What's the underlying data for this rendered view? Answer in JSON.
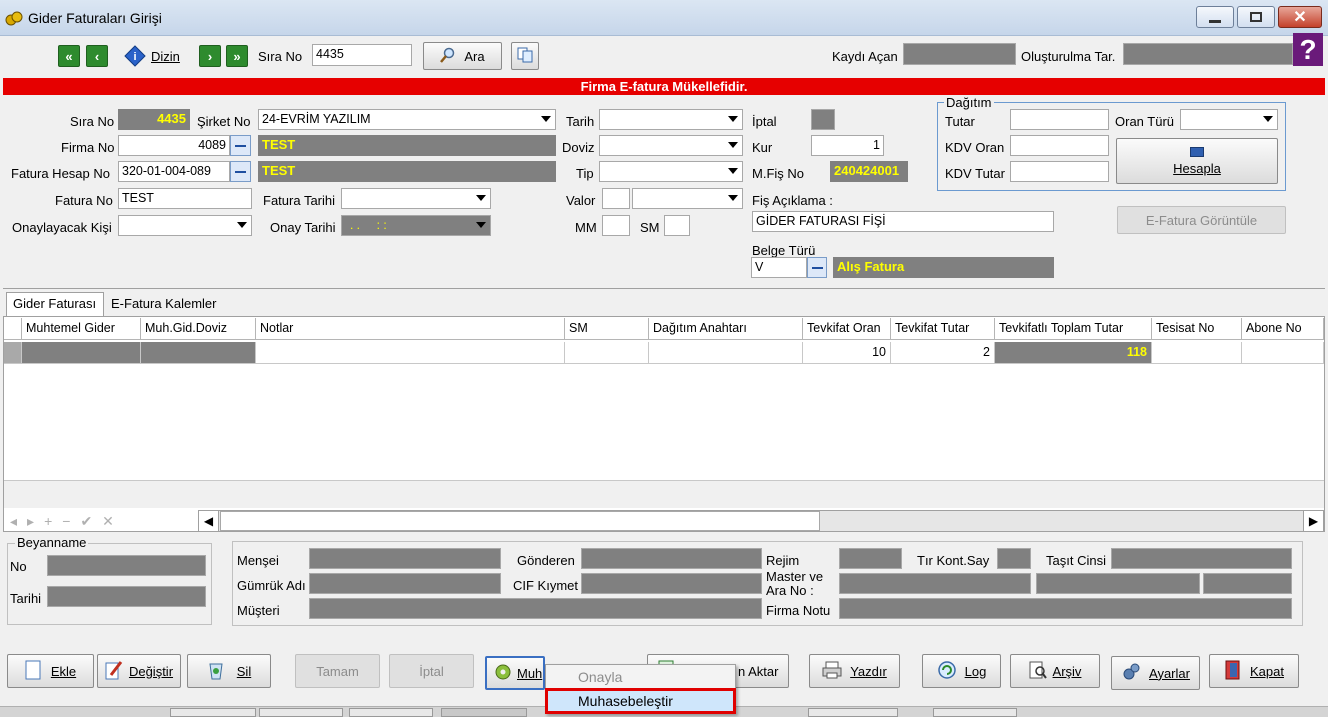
{
  "window": {
    "title": "Gider Faturaları Girişi"
  },
  "toolbar": {
    "dizin_label": "Dizin",
    "sira_no_label": "Sıra No",
    "sira_no_value": "4435",
    "ara_label": "Ara",
    "kaydi_acan_label": "Kaydı Açan",
    "olusturma_label": "Oluşturulma Tar."
  },
  "banner": {
    "text": "Firma E-fatura Mükellefidir."
  },
  "form": {
    "sira_no_label": "Sıra No",
    "sira_no_value": "4435",
    "sirket_no_label": "Şirket No",
    "sirket_no_value": "24-EVRİM YAZILIM",
    "tarih_label": "Tarih",
    "iptal_label": "İptal",
    "firma_no_label": "Firma No",
    "firma_no_value": "4089",
    "firma_name": "TEST",
    "doviz_label": "Doviz",
    "kur_label": "Kur",
    "kur_value": "1",
    "fatura_hesap_label": "Fatura Hesap No",
    "fatura_hesap_value": "320-01-004-089",
    "fatura_hesap_name": "TEST",
    "tip_label": "Tip",
    "mfis_label": "M.Fiş No",
    "mfis_value": "240424001",
    "fatura_no_label": "Fatura No",
    "fatura_no_value": "TEST",
    "fatura_tarihi_label": "Fatura Tarihi",
    "valor_label": "Valor",
    "fis_aciklama_label": "Fiş Açıklama :",
    "fis_aciklama_value": "GİDER FATURASI FİŞİ",
    "onaylayacak_label": "Onaylayacak Kişi",
    "onay_tarihi_label": "Onay Tarihi",
    "onay_tarihi_value": ". .     : :",
    "mm_label": "MM",
    "sm_label": "SM",
    "belge_turu_label": "Belge Türü",
    "belge_turu_value": "V",
    "belge_turu_name": "Alış Fatura"
  },
  "dagitim": {
    "legend": "Dağıtım",
    "tutar_label": "Tutar",
    "oran_turu_label": "Oran Türü",
    "kdv_oran_label": "KDV Oran",
    "kdv_tutar_label": "KDV Tutar",
    "hesapla_label": "Hesapla",
    "efatura_label": "E-Fatura Görüntüle"
  },
  "tabs": [
    {
      "label": "Gider Faturası"
    },
    {
      "label": "E-Fatura Kalemler"
    }
  ],
  "grid": {
    "columns": [
      "Muhtemel Gider",
      "Muh.Gid.Doviz",
      "Notlar",
      "SM",
      "Dağıtım Anahtarı",
      "Tevkifat Oran",
      "Tevkifat Tutar",
      "Tevkifatlı Toplam Tutar",
      "Tesisat No",
      "Abone No"
    ],
    "row": {
      "tevkifat_oran": "10",
      "tevkifat_tutar": "2",
      "toplam": "118"
    }
  },
  "beyanname": {
    "legend": "Beyanname",
    "no_label": "No",
    "tarihi_label": "Tarihi"
  },
  "gumruk": {
    "mensei_label": "Menşei",
    "gonderen_label": "Gönderen",
    "rejim_label": "Rejim",
    "tir_label": "Tır Kont.Say",
    "tasit_label": "Taşıt Cinsi",
    "gumruk_adi_label": "Gümrük Adı",
    "cif_label": "CIF Kıymet",
    "master_label": "Master ve Ara No :",
    "musteri_label": "Müşteri",
    "firma_notu_label": "Firma Notu"
  },
  "actions": {
    "ekle": "Ekle",
    "degistir": "Değiştir",
    "sil": "Sil",
    "tamam": "Tamam",
    "iptal": "İptal",
    "muh": "Muh",
    "aktar": "n Aktar",
    "yazdir": "Yazdır",
    "log": "Log",
    "arsiv": "Arşiv",
    "ayarlar": "Ayarlar",
    "kapat": "Kapat"
  },
  "menu": {
    "onayla": "Onayla",
    "muhasebelestir": "Muhasebeleştir"
  },
  "colors": {
    "banner": "#e60000",
    "gray": "#808080",
    "yellow": "#ffff00",
    "highlight": "#e00000"
  }
}
